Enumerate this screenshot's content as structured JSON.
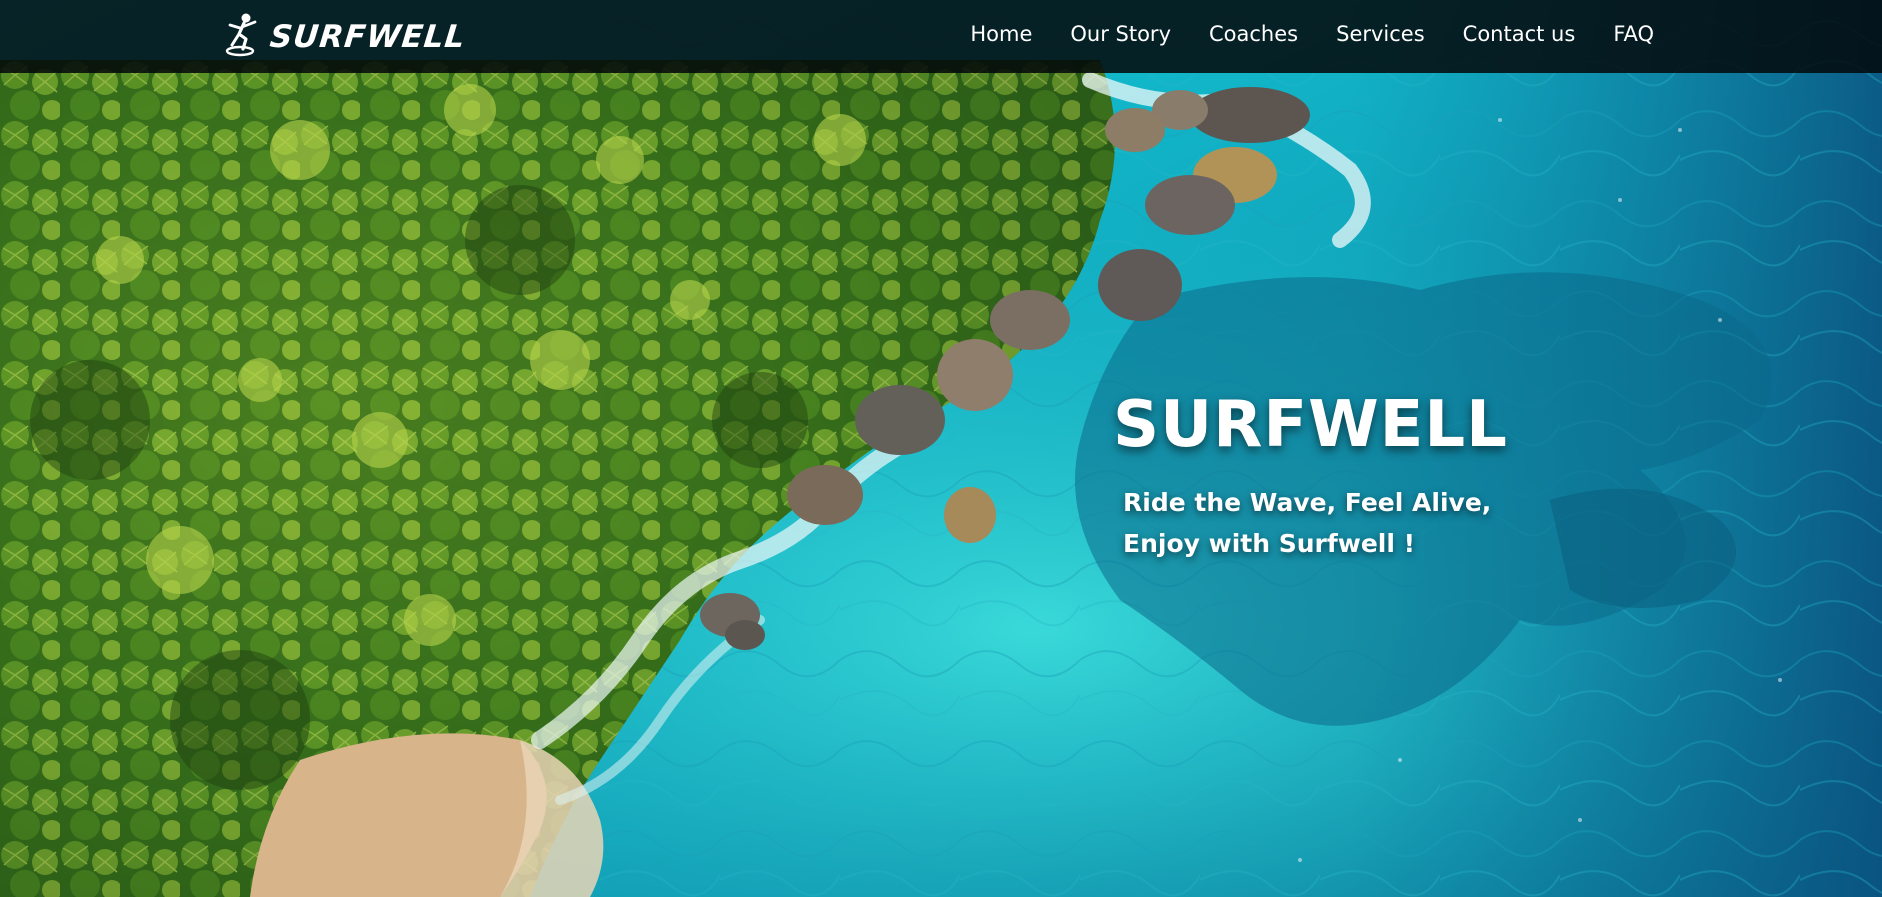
{
  "header": {
    "logo_text": "SURFWELL",
    "logo_icon": "surfer-icon",
    "nav": [
      {
        "label": "Home"
      },
      {
        "label": "Our Story"
      },
      {
        "label": "Coaches"
      },
      {
        "label": "Services"
      },
      {
        "label": "Contact us"
      },
      {
        "label": "FAQ"
      }
    ]
  },
  "hero": {
    "title": "SURFWELL",
    "tagline_line1": "Ride the Wave, Feel Alive,",
    "tagline_line2": "Enjoy with Surfwell !",
    "background_image": "aerial view of tropical coastline with palm jungle, rocks and turquoise sea"
  },
  "colors": {
    "navbar_bg": "#03080a",
    "text": "#ffffff",
    "sea_light": "#19c9cf",
    "sea_deep": "#0a6f8f",
    "jungle": "#2f6b1d"
  }
}
